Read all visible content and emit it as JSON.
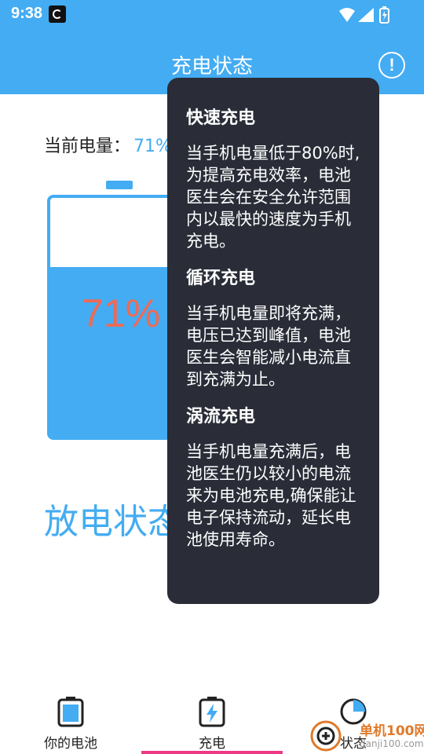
{
  "status_bar": {
    "time": "9:38"
  },
  "app_bar": {
    "title": "充电状态",
    "info_label": "!"
  },
  "battery": {
    "level_label": "当前电量：",
    "level_value": "71%",
    "percent_text": "71%",
    "level_fraction": 0.71
  },
  "discharge": {
    "title": "放电状态"
  },
  "popover": {
    "sections": [
      {
        "heading": "快速充电",
        "body": "当手机电量低于80%时,为提高充电效率，电池医生会在安全允许范围内以最快的速度为手机充电。"
      },
      {
        "heading": "循环充电",
        "body": "当手机电量即将充满，电压已达到峰值，电池医生会智能减小电流直到充满为止。"
      },
      {
        "heading": "涡流充电",
        "body": "当手机电量充满后，电池医生仍以较小的电流来为电池充电,确保能让电子保持流动，延长电池使用寿命。"
      }
    ]
  },
  "bottom_nav": {
    "items": [
      {
        "label": "你的电池",
        "icon": "battery-icon"
      },
      {
        "label": "充电",
        "icon": "charging-battery-icon"
      },
      {
        "label": "状态",
        "icon": "pie-chart-icon"
      }
    ],
    "active_index": 1
  },
  "watermark": {
    "text": "单机100网",
    "url": "danji100.com"
  },
  "colors": {
    "primary": "#44acf2",
    "percent": "#ef6a55",
    "popover_bg": "#2a2d38",
    "active_tab": "#ee3a86"
  }
}
